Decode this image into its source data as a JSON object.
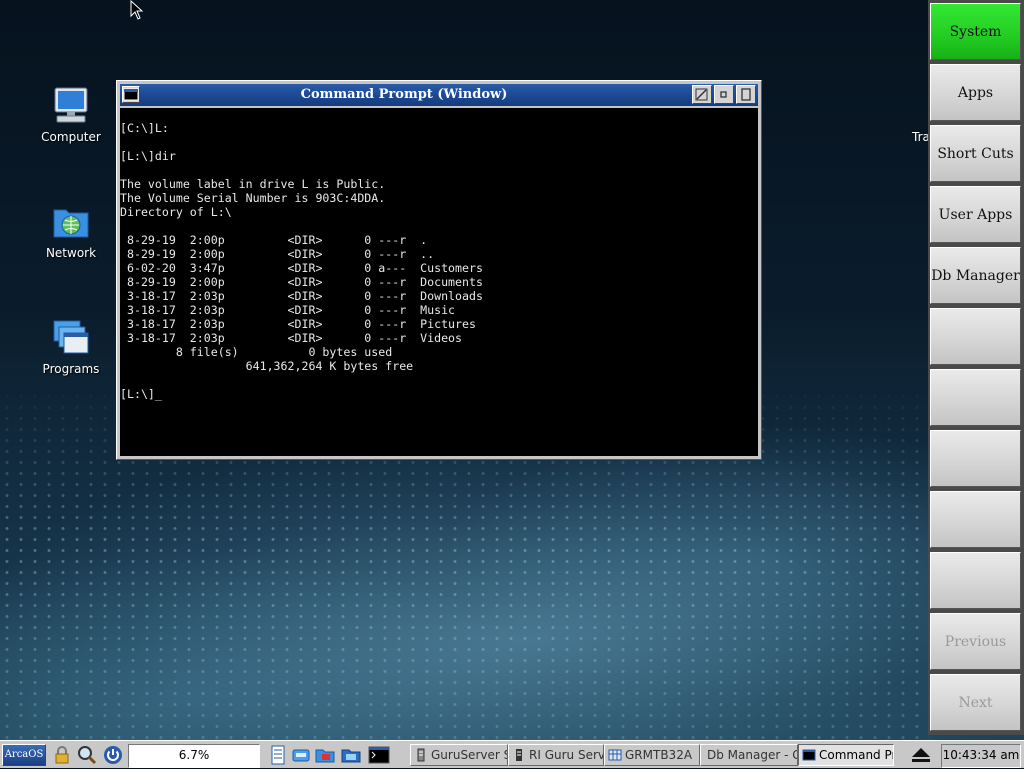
{
  "desktop": {
    "icons": [
      {
        "label": "Computer",
        "icon": "computer-icon"
      },
      {
        "label": "Network",
        "icon": "network-folder-icon"
      },
      {
        "label": "Programs",
        "icon": "programs-folder-icon"
      }
    ],
    "partial_label": "Tra"
  },
  "window": {
    "title": "Command Prompt (Window)",
    "lines": [
      "[C:\\]L:",
      "",
      "[L:\\]dir",
      "",
      "The volume label in drive L is Public.",
      "The Volume Serial Number is 903C:4DDA.",
      "Directory of L:\\",
      "",
      " 8-29-19  2:00p         <DIR>      0 ---r  .",
      " 8-29-19  2:00p         <DIR>      0 ---r  ..",
      " 6-02-20  3:47p         <DIR>      0 a---  Customers",
      " 8-29-19  2:00p         <DIR>      0 ---r  Documents",
      " 3-18-17  2:03p         <DIR>      0 ---r  Downloads",
      " 3-18-17  2:03p         <DIR>      0 ---r  Music",
      " 3-18-17  2:03p         <DIR>      0 ---r  Pictures",
      " 3-18-17  2:03p         <DIR>      0 ---r  Videos",
      "        8 file(s)          0 bytes used",
      "                  641,362,264 K bytes free",
      "",
      "[L:\\]_"
    ]
  },
  "launch_panel": {
    "buttons": [
      {
        "label": "System",
        "active": true
      },
      {
        "label": "Apps"
      },
      {
        "label": "Short Cuts"
      },
      {
        "label": "User Apps"
      },
      {
        "label": "Db Manager"
      },
      {
        "label": ""
      },
      {
        "label": ""
      },
      {
        "label": ""
      },
      {
        "label": ""
      },
      {
        "label": ""
      },
      {
        "label": "Previous",
        "disabled": true
      },
      {
        "label": "Next",
        "disabled": true
      }
    ]
  },
  "taskbar": {
    "start_label": "ArcaOS",
    "cpu_load": "6.7%",
    "tasks": [
      {
        "label": "GuruServer S"
      },
      {
        "label": "RI Guru Serve"
      },
      {
        "label": "GRMTB32A"
      },
      {
        "label": "Db Manager - G"
      },
      {
        "label": "Command Pr",
        "active": true
      }
    ],
    "clock": "10:43:34 am"
  },
  "colors": {
    "titlebar": "#1c4a96",
    "active_launch": "#22cc22",
    "terminal_bg": "#000000",
    "terminal_fg": "#e8e8e8"
  }
}
